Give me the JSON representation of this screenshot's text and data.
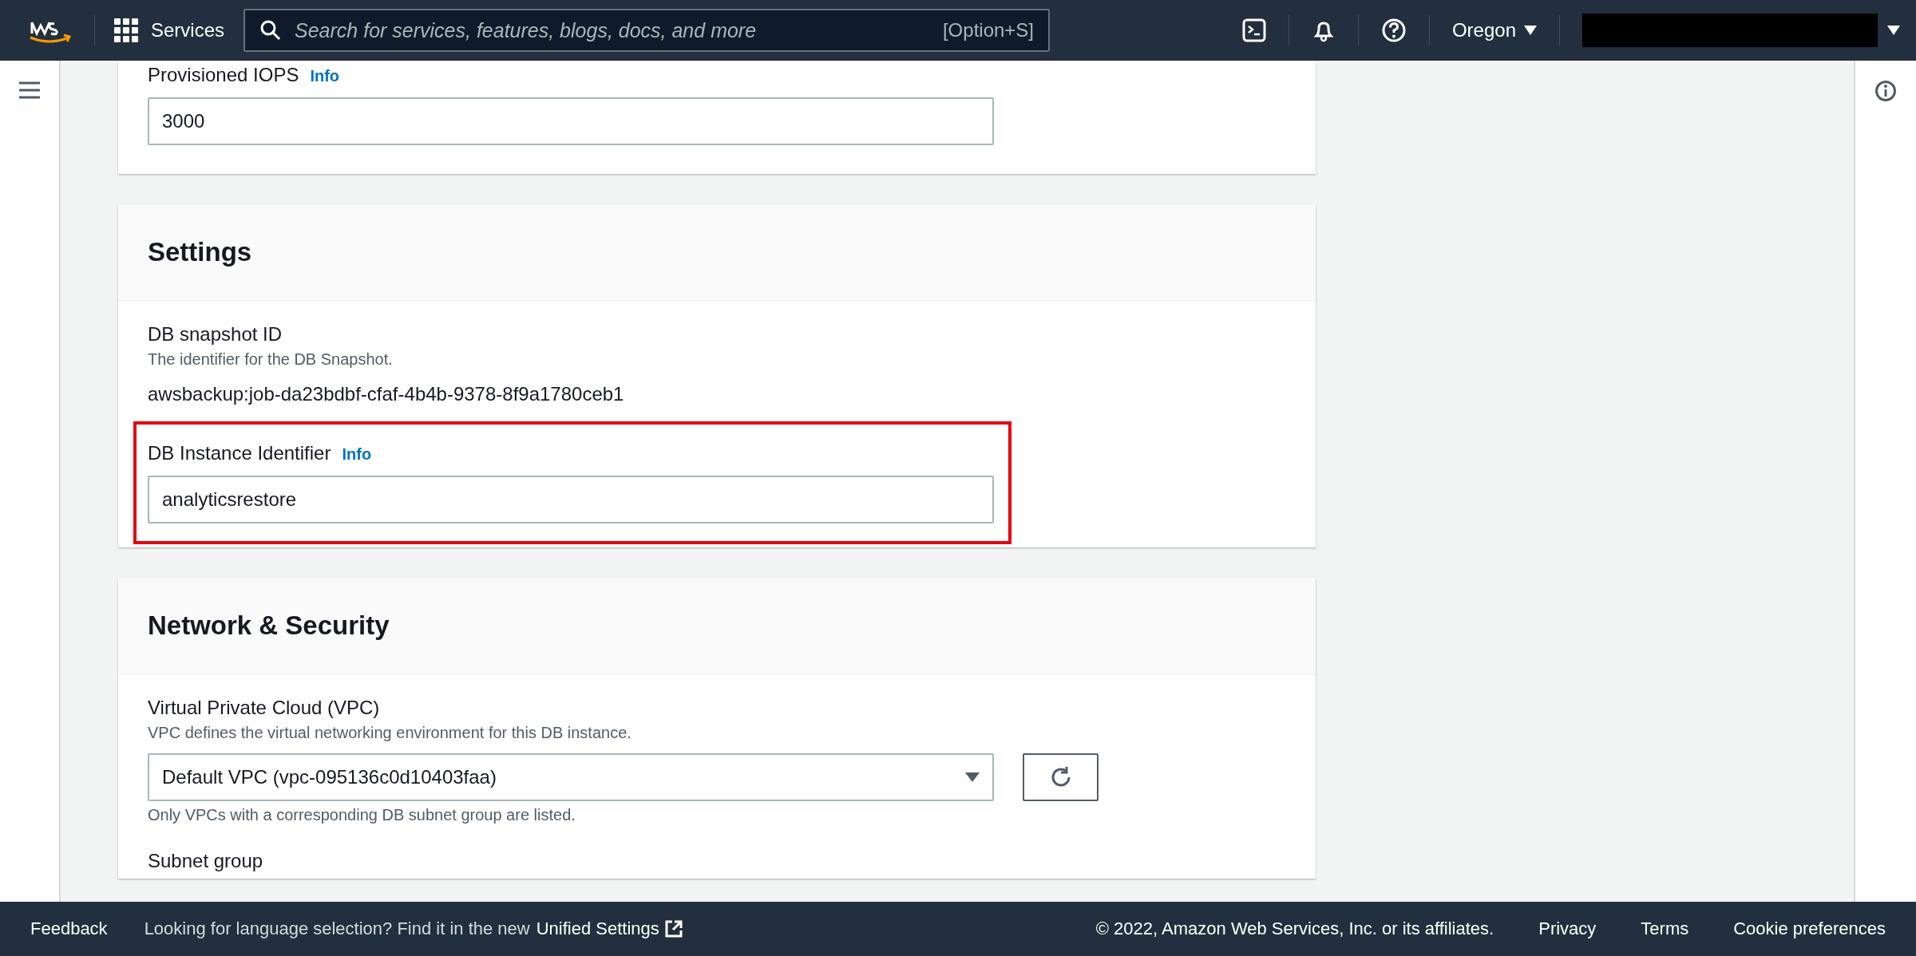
{
  "top_nav": {
    "services": "Services",
    "search_placeholder": "Search for services, features, blogs, docs, and more",
    "search_shortcut": "[Option+S]",
    "region": "Oregon"
  },
  "sections": [
    {
      "fields": [
        {
          "kind": "input",
          "label": "Provisioned IOPS",
          "info": "Info",
          "value": "3000"
        }
      ]
    },
    {
      "title": "Settings",
      "fields": [
        {
          "kind": "readonly",
          "label": "DB snapshot ID",
          "description": "The identifier for the DB Snapshot.",
          "value": "awsbackup:job-da23bdbf-cfaf-4b4b-9378-8f9a1780ceb1"
        },
        {
          "kind": "input",
          "label": "DB Instance Identifier",
          "info": "Info",
          "value": "analyticsrestore",
          "highlighted": true
        }
      ]
    },
    {
      "title": "Network & Security",
      "fields": [
        {
          "kind": "select",
          "label": "Virtual Private Cloud (VPC)",
          "description": "VPC defines the virtual networking environment for this DB instance.",
          "value": "Default VPC (vpc-095136c0d10403faa)",
          "hint": "Only VPCs with a corresponding DB subnet group are listed."
        },
        {
          "kind": "label",
          "label": "Subnet group"
        }
      ]
    }
  ],
  "footer": {
    "feedback": "Feedback",
    "language_note": "Looking for language selection? Find it in the new",
    "language_link": "Unified Settings",
    "copyright": "© 2022, Amazon Web Services, Inc. or its affiliates.",
    "links": [
      "Privacy",
      "Terms",
      "Cookie preferences"
    ]
  }
}
